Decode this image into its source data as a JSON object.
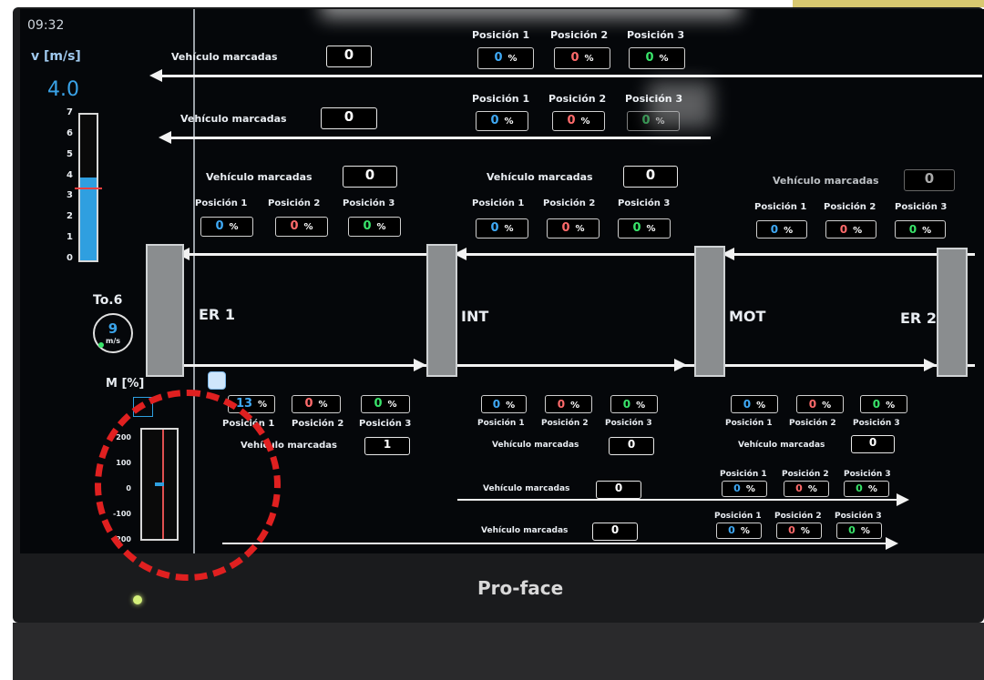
{
  "clock": "09:32",
  "speed": {
    "label": "v [m/s]",
    "value": "4.0",
    "scale": [
      "7",
      "6",
      "5",
      "4",
      "3",
      "2",
      "1",
      "0"
    ],
    "level": 4.0,
    "max": 7
  },
  "trafo": {
    "label": "To.6",
    "value": "9",
    "unit": "m/s"
  },
  "motor": {
    "label": "M [%]",
    "scale": [
      "200",
      "100",
      "0",
      "-100",
      "-200"
    ],
    "level": 0
  },
  "stations": {
    "er1": "ER 1",
    "int": "INT",
    "mot": "MOT",
    "er2": "ER 2"
  },
  "pos_labels": {
    "p1": "Posición 1",
    "p2": "Posición 2",
    "p3": "Posición 3"
  },
  "vehiculo_label": "Vehículo marcadas",
  "unit_pct": "%",
  "top_lanes": [
    {
      "count": "0",
      "p1": "0",
      "p2": "0",
      "p3": "0"
    },
    {
      "count": "0",
      "p1": "0",
      "p2": "0",
      "p3": "0"
    }
  ],
  "upper_sections": [
    {
      "count": "0",
      "p1": "0",
      "p2": "0",
      "p3": "0"
    },
    {
      "count": "0",
      "p1": "0",
      "p2": "0",
      "p3": "0"
    },
    {
      "count": "0",
      "p1": "0",
      "p2": "0",
      "p3": "0"
    }
  ],
  "lower_sections": [
    {
      "count": "1",
      "p1": "13",
      "p2": "0",
      "p3": "0"
    },
    {
      "count": "0",
      "p1": "0",
      "p2": "0",
      "p3": "0"
    },
    {
      "count": "0",
      "p1": "0",
      "p2": "0",
      "p3": "0"
    }
  ],
  "bottom_lanes": [
    {
      "count": "0",
      "p1": "0",
      "p2": "0",
      "p3": "0"
    },
    {
      "count": "0",
      "p1": "0",
      "p2": "0",
      "p3": "0"
    }
  ],
  "brand": "Pro-face",
  "colors": {
    "pos1": "#3fa9f5",
    "pos2": "#ff6b6b",
    "pos3": "#39e46a",
    "annotation": "#e02020",
    "bar": "#2f9fe0"
  }
}
